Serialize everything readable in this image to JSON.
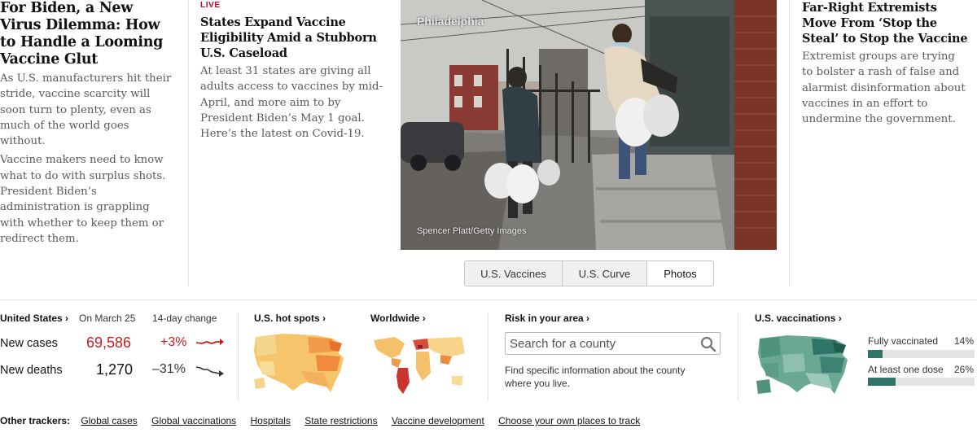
{
  "stories": {
    "left": {
      "headline": "For Biden, a New Virus Dilemma: How to Handle a Looming Vaccine Glut",
      "summary1": "As U.S. manufacturers hit their stride, vaccine scarcity will soon turn to plenty, even as much of the world goes without.",
      "summary2": "Vaccine makers need to know what to do with surplus shots. President Biden’s administration is grappling with whether to keep them or redirect them."
    },
    "live": {
      "kicker": "LIVE",
      "headline": "States Expand Vaccine Eligibility Amid a Stubborn U.S. Caseload",
      "summary": "At least 31 states are giving all adults access to vaccines by mid-April, and more aim to by President Biden’s May 1 goal. Here’s the latest on Covid-19."
    },
    "photo": {
      "place_label": "Philadelphia",
      "credit": "Spencer Platt/Getty Images"
    },
    "right": {
      "headline": "Far-Right Extremists Move From ‘Stop the Steal’ to Stop the Vaccine",
      "summary": "Extremist groups are trying to bolster a rash of false and alarmist disinformation about vaccines in an effort to undermine the government."
    }
  },
  "photo_tabs": [
    {
      "label": "U.S. Vaccines",
      "active": false
    },
    {
      "label": "U.S. Curve",
      "active": false
    },
    {
      "label": "Photos",
      "active": true
    }
  ],
  "tracker": {
    "us": {
      "title": "United States ›",
      "date_header": "On March 25",
      "change_header": "14-day change",
      "cases_label": "New cases",
      "cases_value": "69,586",
      "cases_change": "+3%",
      "deaths_label": "New deaths",
      "deaths_value": "1,270",
      "deaths_change": "–31%"
    },
    "hotspots_title": "U.S. hot spots ›",
    "worldwide_title": "Worldwide ›",
    "risk": {
      "title": "Risk in your area ›",
      "placeholder": "Search for a county",
      "help": "Find specific information about the county where you live."
    },
    "vaccinations": {
      "title": "U.S. vaccinations ›",
      "fully_label": "Fully vaccinated",
      "fully_value": "14%",
      "fully_fraction": 0.14,
      "one_dose_label": "At least one dose",
      "one_dose_value": "26%",
      "one_dose_fraction": 0.26,
      "bar_color": "#2f7466"
    }
  },
  "other_trackers": {
    "label": "Other trackers:",
    "links": [
      "Global cases",
      "Global vaccinations",
      "Hospitals",
      "State restrictions",
      "Vaccine development",
      "Choose your own places to track"
    ]
  },
  "colors": {
    "live_red": "#d0021b",
    "cases_red": "#cc1d1d",
    "vaccine_green": "#2f7466"
  }
}
